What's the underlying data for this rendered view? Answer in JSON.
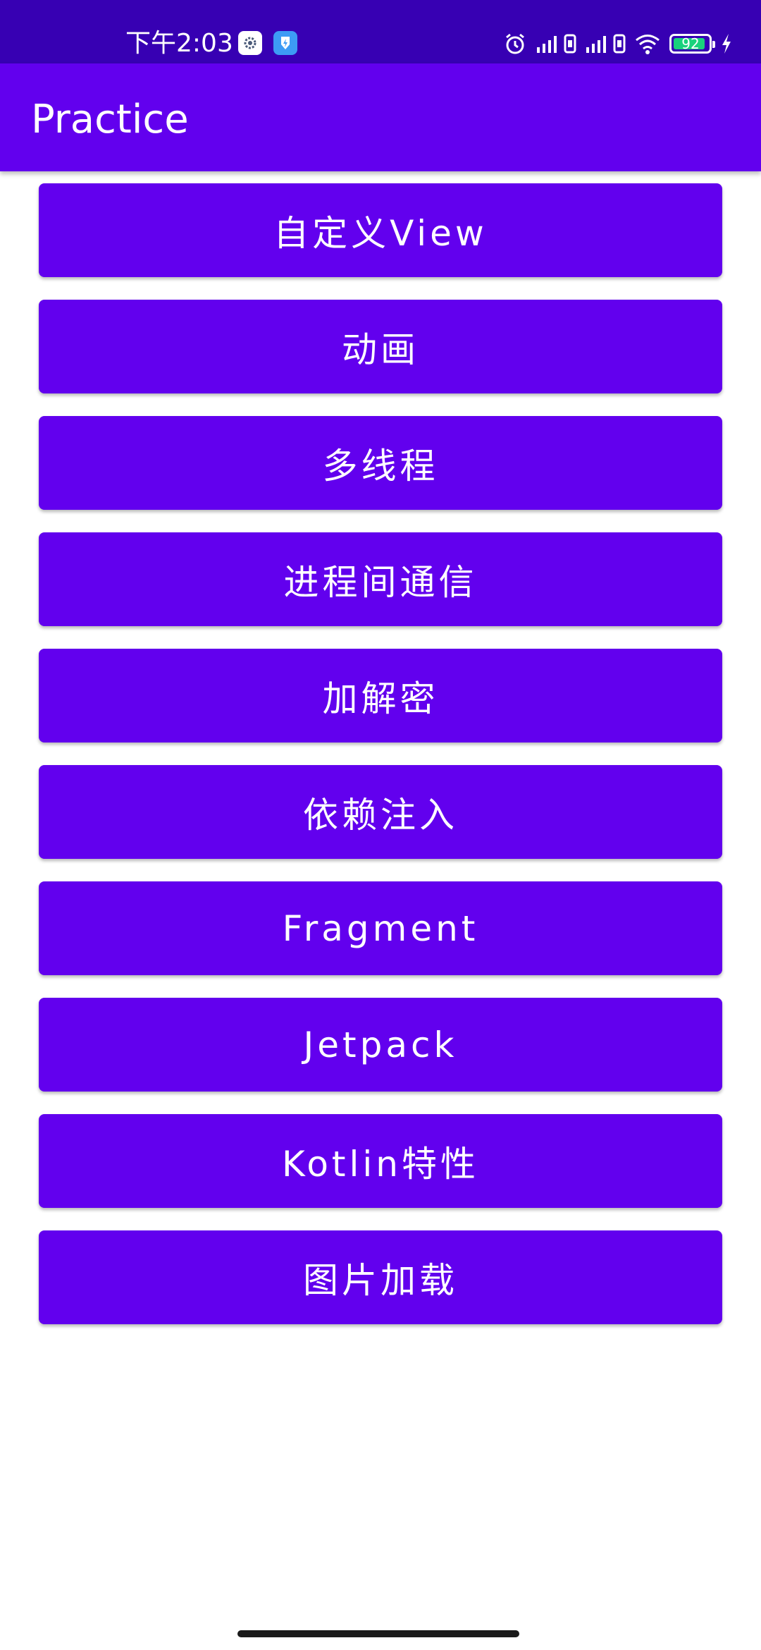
{
  "status_bar": {
    "time": "下午2:03",
    "battery_level": "92",
    "battery_fraction": 0.92,
    "icons": [
      "settings-app-icon",
      "flash-app-icon",
      "alarm-icon",
      "signal-icon",
      "sim-1-icon",
      "signal-icon",
      "sim-2-icon",
      "wifi-icon",
      "battery-icon",
      "charging-icon"
    ],
    "colors": {
      "background": "#3700B3",
      "battery_fill": "#19D27C",
      "flash_app": "#3D9BF5"
    }
  },
  "app_bar": {
    "title": "Practice",
    "color": "#6200EE"
  },
  "menu": {
    "items": [
      {
        "label": "自定义View"
      },
      {
        "label": "动画"
      },
      {
        "label": "多线程"
      },
      {
        "label": "进程间通信"
      },
      {
        "label": "加解密"
      },
      {
        "label": "依赖注入"
      },
      {
        "label": "Fragment"
      },
      {
        "label": "Jetpack"
      },
      {
        "label": "Kotlin特性"
      },
      {
        "label": "图片加载"
      }
    ],
    "button_color": "#6200EE"
  }
}
